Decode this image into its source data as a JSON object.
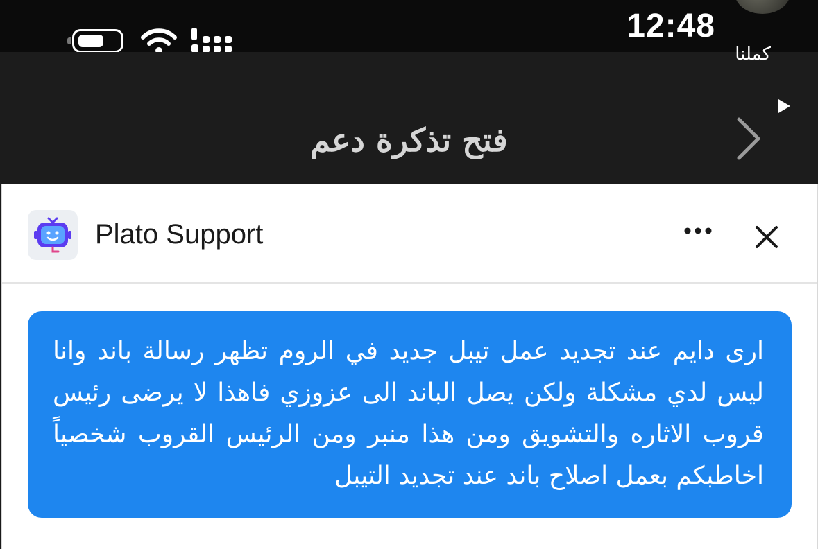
{
  "status_bar": {
    "time": "12:48",
    "back_app_label": "كملنا"
  },
  "nav": {
    "title": "فتح تذكرة دعم"
  },
  "panel": {
    "app_name": "Plato Support",
    "icons": {
      "logo": "robot-support-icon",
      "more": "more-icon",
      "close": "close-icon"
    }
  },
  "message": {
    "text": "ارى دايم عند تجديد عمل تيبل جديد في الروم تظهر رسالة باند وانا ليس لدي مشكلة ولكن يصل الباند الى عزوزي فاهذا لا يرضى رئيس قروب الاثاره والتشويق ومن هذا منبر ومن الرئيس القروب شخصياً اخاطبكم بعمل اصلاح باند عند تجديد التيبل",
    "bubble_color": "#1e86ef"
  },
  "colors": {
    "nav_background": "#1c1c1c",
    "accent": "#1e86ef"
  }
}
